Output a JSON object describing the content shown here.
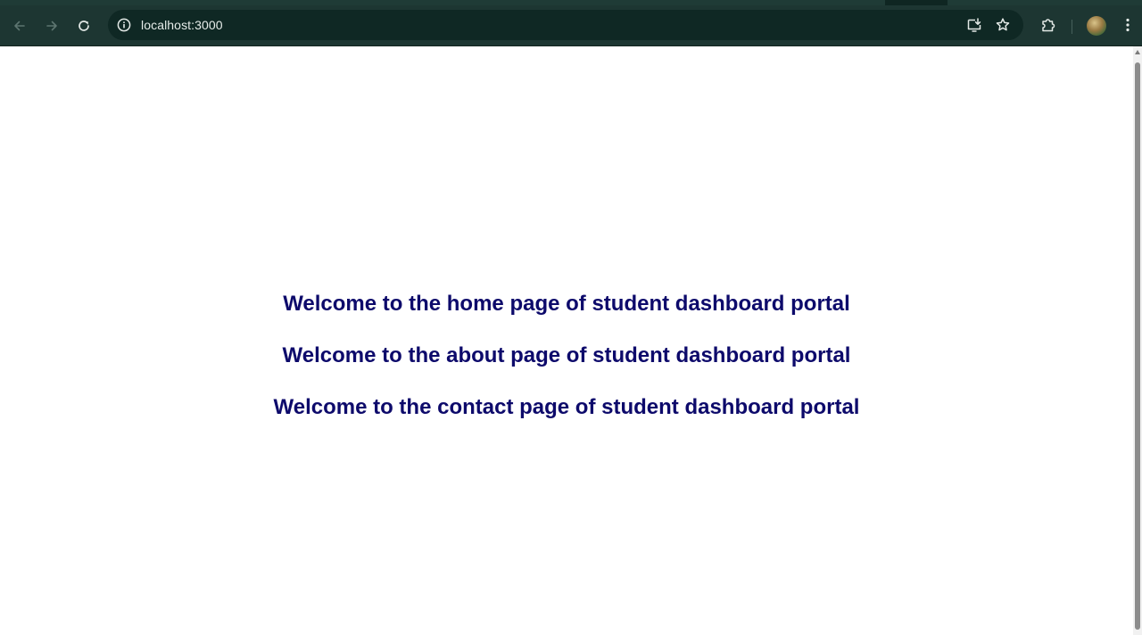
{
  "browser": {
    "url": "localhost:3000",
    "icons": {
      "back": "back-arrow-icon",
      "forward": "forward-arrow-icon",
      "reload": "reload-icon",
      "site_info": "info-icon",
      "install": "install-app-icon",
      "bookmark": "star-icon",
      "extensions": "puzzle-icon",
      "profile": "avatar",
      "menu": "kebab-menu-icon"
    },
    "colors": {
      "toolbar": "#1d3632",
      "omnibox": "#0f2824",
      "heading_text": "#0d0a6b"
    }
  },
  "page": {
    "headings": [
      "Welcome to the home page of student dashboard portal",
      "Welcome to the about page of student dashboard portal",
      "Welcome to the contact page of student dashboard portal"
    ]
  }
}
